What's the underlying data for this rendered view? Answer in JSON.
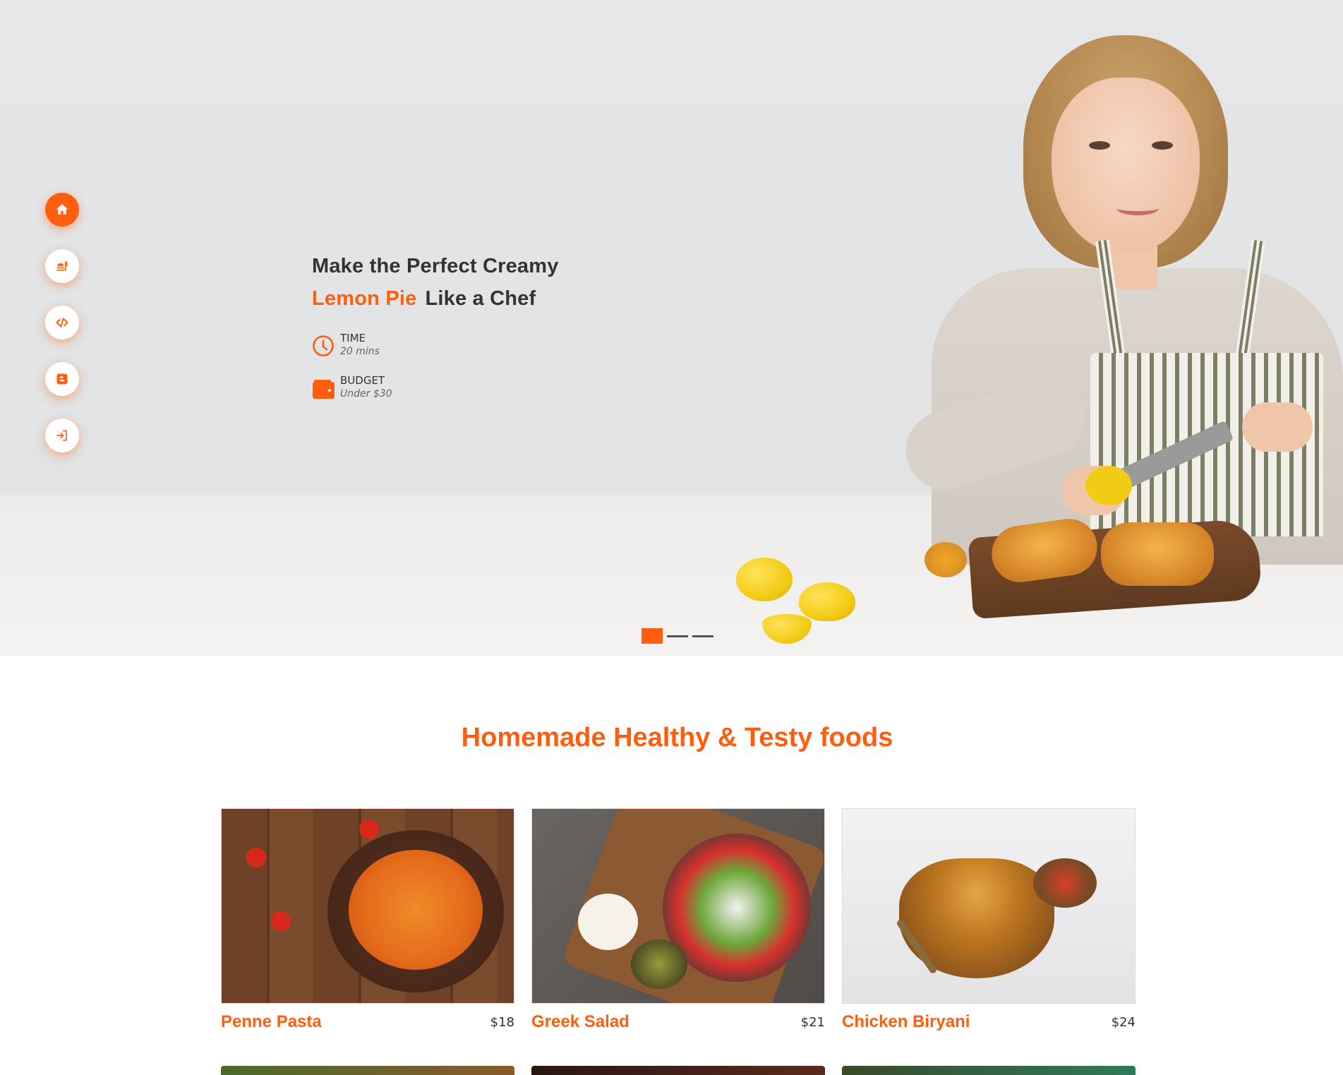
{
  "colors": {
    "accent": "#ff5e0e",
    "text": "#333333",
    "muted": "#666666"
  },
  "sidenav": [
    {
      "name": "home-icon",
      "active": true
    },
    {
      "name": "food-menu-icon",
      "active": false
    },
    {
      "name": "code-icon",
      "active": false
    },
    {
      "name": "blogger-icon",
      "active": false
    },
    {
      "name": "login-icon",
      "active": false
    }
  ],
  "hero": {
    "title_line1": "Make the Perfect Creamy",
    "title_accent": "Lemon Pie",
    "title_line2_rest": "Like a Chef",
    "time_label": "TIME",
    "time_value": "20 mins",
    "budget_label": "BUDGET",
    "budget_value": "Under $30",
    "slides": 3,
    "active_slide": 1
  },
  "section": {
    "title": "Homemade Healthy & Testy foods"
  },
  "foods": [
    {
      "name": "Penne Pasta",
      "price": "$18"
    },
    {
      "name": "Greek Salad",
      "price": "$21"
    },
    {
      "name": "Chicken Biryani",
      "price": "$24"
    }
  ]
}
